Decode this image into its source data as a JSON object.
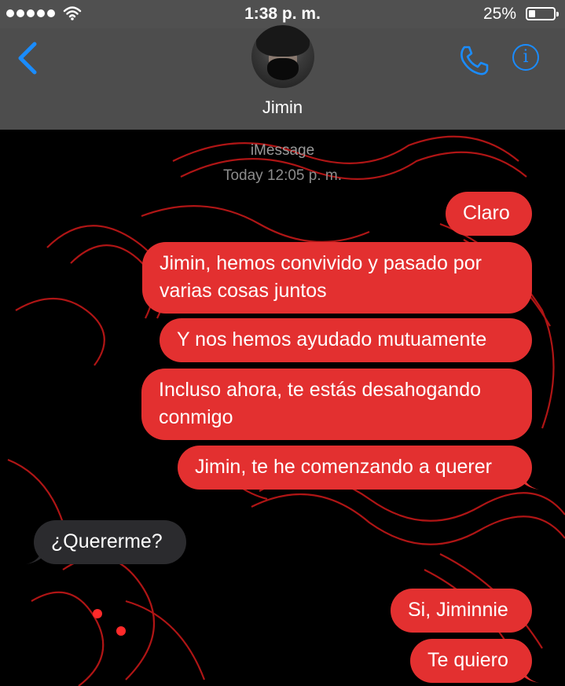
{
  "status_bar": {
    "time": "1:38 p. m.",
    "battery_percent": "25%",
    "battery_level": 0.25
  },
  "header": {
    "contact_name": "Jimin",
    "back_icon": "chevron-left-icon",
    "call_icon": "phone-icon",
    "info_icon": "info-icon",
    "info_glyph": "i",
    "accent_color": "#1a8cff"
  },
  "conversation": {
    "service_label": "iMessage",
    "timestamp": "Today 12:05 p. m.",
    "messages": [
      {
        "from": "me",
        "text": "Claro"
      },
      {
        "from": "me",
        "text": "Jimin, hemos convivido y pasado por varias cosas juntos"
      },
      {
        "from": "me",
        "text": "Y nos hemos ayudado mutuamente"
      },
      {
        "from": "me",
        "text": "Incluso ahora, te estás desahogando conmigo"
      },
      {
        "from": "me",
        "text": "Jimin, te he comenzando a querer"
      },
      {
        "from": "them",
        "text": "¿Quererme?"
      },
      {
        "from": "me",
        "text": "Si, Jiminnie"
      },
      {
        "from": "me",
        "text": "Te quiero"
      }
    ],
    "sent_color": "#e33030",
    "received_color": "#2b2b2e",
    "wallpaper": "red neon dragon"
  }
}
